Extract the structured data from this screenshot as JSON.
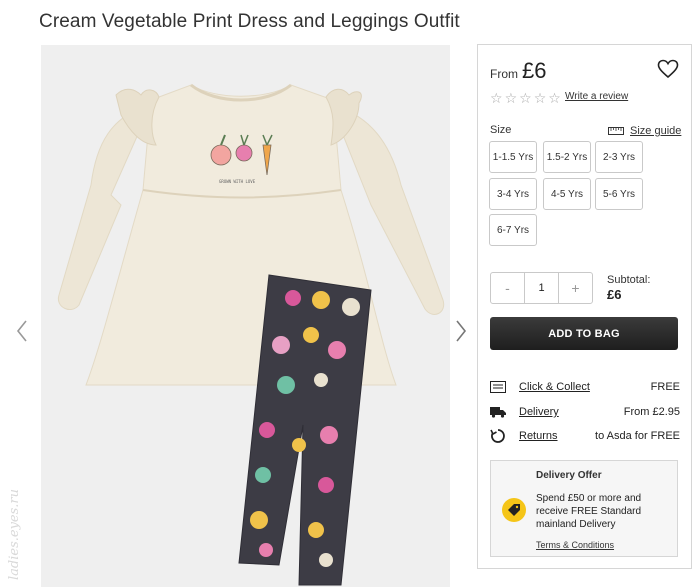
{
  "product": {
    "title": "Cream Vegetable Print Dress and Leggings Outfit"
  },
  "gallery": {
    "prev_icon": "chevron-left-icon",
    "next_icon": "chevron-right-icon",
    "watermark": "ladies.eyes.ru"
  },
  "panel": {
    "from_label": "From",
    "price": "£6",
    "favourite_icon": "heart-icon",
    "rating_stars": 0,
    "rating_max": 5,
    "review_link": "Write a review",
    "size_label": "Size",
    "size_guide_label": "Size guide",
    "sizes": [
      "1-1.5 Yrs",
      "1.5-2 Yrs",
      "2-3 Yrs",
      "3-4 Yrs",
      "4-5 Yrs",
      "5-6 Yrs",
      "6-7 Yrs"
    ],
    "quantity": {
      "minus": "-",
      "value": "1",
      "plus": "+"
    },
    "subtotal_label": "Subtotal:",
    "subtotal_value": "£6",
    "add_to_bag": "ADD TO BAG",
    "delivery_options": [
      {
        "icon": "store-icon",
        "label": "Click & Collect",
        "value": "FREE"
      },
      {
        "icon": "truck-icon",
        "label": "Delivery",
        "value": "From £2.95"
      },
      {
        "icon": "return-icon",
        "label": "Returns",
        "value": "to Asda for FREE"
      }
    ],
    "offer": {
      "title": "Delivery Offer",
      "icon": "tag-icon",
      "text": "Spend £50 or more and receive FREE Standard mainland Delivery",
      "terms": "Terms & Conditions"
    }
  },
  "colors": {
    "accent_yellow": "#f5c518",
    "button_dark": "#2a2a2a",
    "image_bg": "#efefef"
  }
}
